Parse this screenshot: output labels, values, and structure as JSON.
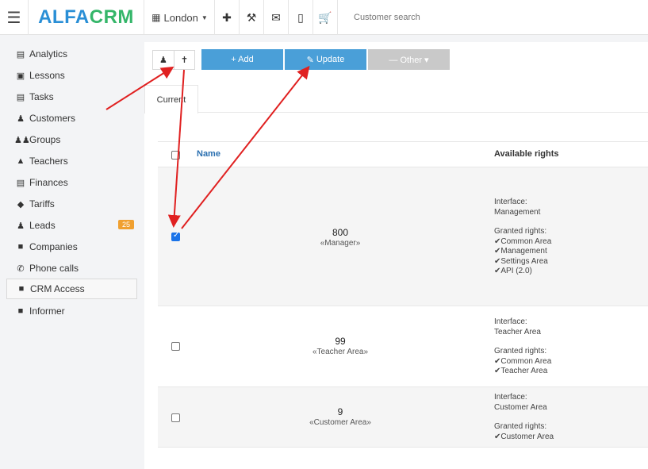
{
  "topbar": {
    "logo_part1": "ALFA",
    "logo_part2": "CRM",
    "branch": "London",
    "search_placeholder": "Customer search"
  },
  "sidebar": {
    "items": [
      {
        "label": "Analytics",
        "icon": "map-icon"
      },
      {
        "label": "Lessons",
        "icon": "calendar-icon"
      },
      {
        "label": "Tasks",
        "icon": "clipboard-icon"
      },
      {
        "label": "Customers",
        "icon": "user-icon"
      },
      {
        "label": "Groups",
        "icon": "users-icon"
      },
      {
        "label": "Teachers",
        "icon": "graduation-cap-icon"
      },
      {
        "label": "Finances",
        "icon": "money-icon"
      },
      {
        "label": "Tariffs",
        "icon": "tag-icon"
      },
      {
        "label": "Leads",
        "icon": "user-plus-icon",
        "badge": "25"
      },
      {
        "label": "Companies",
        "icon": "briefcase-icon"
      },
      {
        "label": "Phone calls",
        "icon": "phone-icon"
      },
      {
        "label": "CRM Access",
        "icon": "lock-icon",
        "active": true
      },
      {
        "label": "Informer",
        "icon": "book-icon"
      }
    ]
  },
  "toolbar": {
    "add_label": "+ Add",
    "update_label": "Update",
    "other_label": "— Other ▾"
  },
  "tabs": {
    "current": "Current"
  },
  "table": {
    "headers": {
      "name": "Name",
      "rights": "Available rights"
    },
    "rows": [
      {
        "number": "800",
        "role": "«Manager»",
        "checked": true,
        "interface_label": "Interface:",
        "interface": "Management",
        "granted_label": "Granted rights:",
        "rights": [
          "✔Common Area",
          "✔Management",
          "✔Settings Area",
          "✔API (2.0)"
        ]
      },
      {
        "number": "99",
        "role": "«Teacher Area»",
        "checked": false,
        "interface_label": "Interface:",
        "interface": "Teacher Area",
        "granted_label": "Granted rights:",
        "rights": [
          "✔Common Area",
          "✔Teacher Area"
        ]
      },
      {
        "number": "9",
        "role": "«Customer Area»",
        "checked": false,
        "interface_label": "Interface:",
        "interface": "Customer Area",
        "granted_label": "Granted rights:",
        "rights": [
          "✔Customer Area"
        ]
      }
    ]
  },
  "colors": {
    "accent": "#4a9fd8",
    "logo_blue": "#2a8fd6",
    "logo_green": "#35b66a",
    "badge": "#f0a030",
    "annotation_arrow": "#e02020"
  }
}
